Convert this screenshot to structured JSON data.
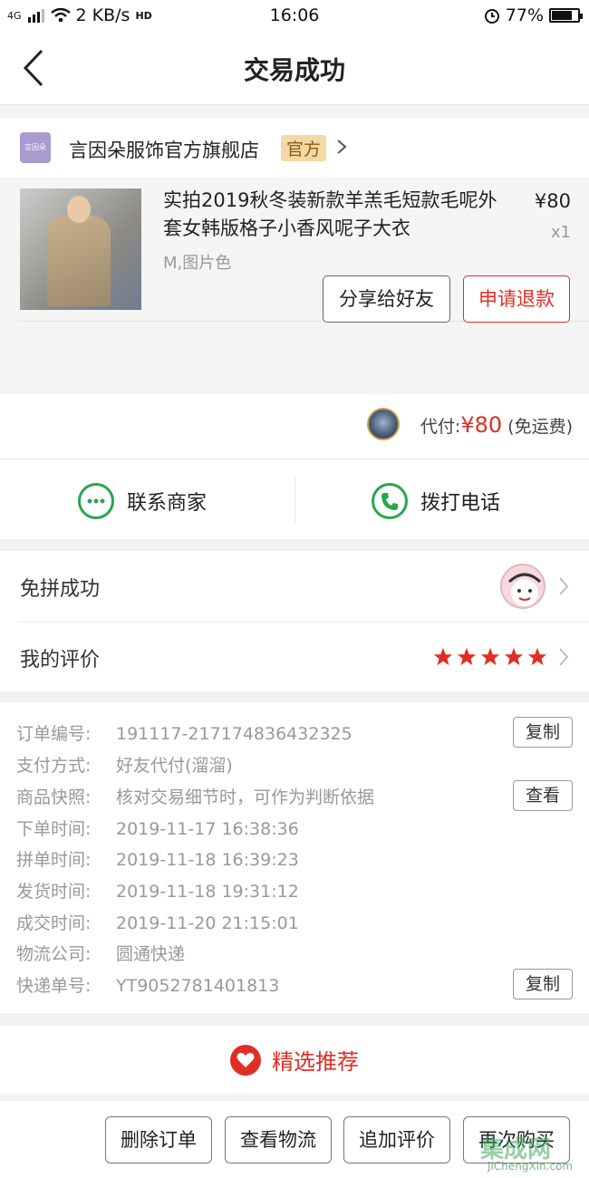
{
  "status_bar": {
    "network": "4G",
    "speed": "2 KB/s",
    "hd": "HD",
    "time": "16:06",
    "battery": "77%",
    "battery_level": 0.77
  },
  "nav": {
    "title": "交易成功"
  },
  "shop": {
    "logo_text": "言因朵",
    "name": "言因朵服饰官方旗舰店",
    "badge": "官方"
  },
  "product": {
    "title": "实拍2019秋冬装新款羊羔毛短款毛呢外套女韩版格子小香风呢子大衣",
    "spec": "M,图片色",
    "price": "¥80",
    "qty": "x1"
  },
  "actions": {
    "share": "分享给好友",
    "refund": "申请退款"
  },
  "payment": {
    "label": "代付:",
    "amount": "¥80",
    "note": "(免运费)"
  },
  "contact": {
    "merchant": "联系商家",
    "call": "拨打电话"
  },
  "status_rows": {
    "group": "免拼成功",
    "review": "我的评价",
    "rating": 5
  },
  "order_info": {
    "rows": [
      {
        "k": "订单编号:",
        "v": "191117-217174836432325",
        "action": "复制"
      },
      {
        "k": "支付方式:",
        "v": "好友代付(溜溜)"
      },
      {
        "k": "商品快照:",
        "v": "核对交易细节时，可作为判断依据",
        "action": "查看"
      },
      {
        "k": "下单时间:",
        "v": "2019-11-17 16:38:36"
      },
      {
        "k": "拼单时间:",
        "v": "2019-11-18 16:39:23"
      },
      {
        "k": "发货时间:",
        "v": "2019-11-18 19:31:12"
      },
      {
        "k": "成交时间:",
        "v": "2019-11-20 21:15:01"
      },
      {
        "k": "物流公司:",
        "v": "圆通快递"
      },
      {
        "k": "快递单号:",
        "v": "YT9052781401813",
        "action": "复制"
      }
    ]
  },
  "recommend": {
    "label": "精选推荐"
  },
  "bottom": {
    "delete": "删除订单",
    "logistics": "查看物流",
    "add_review": "追加评价",
    "rebuy": "再次购买"
  },
  "watermark": {
    "main": "集成网",
    "sub": "JiChengXin.com"
  },
  "colors": {
    "accent": "#e02e24",
    "green": "#2aa54f"
  }
}
